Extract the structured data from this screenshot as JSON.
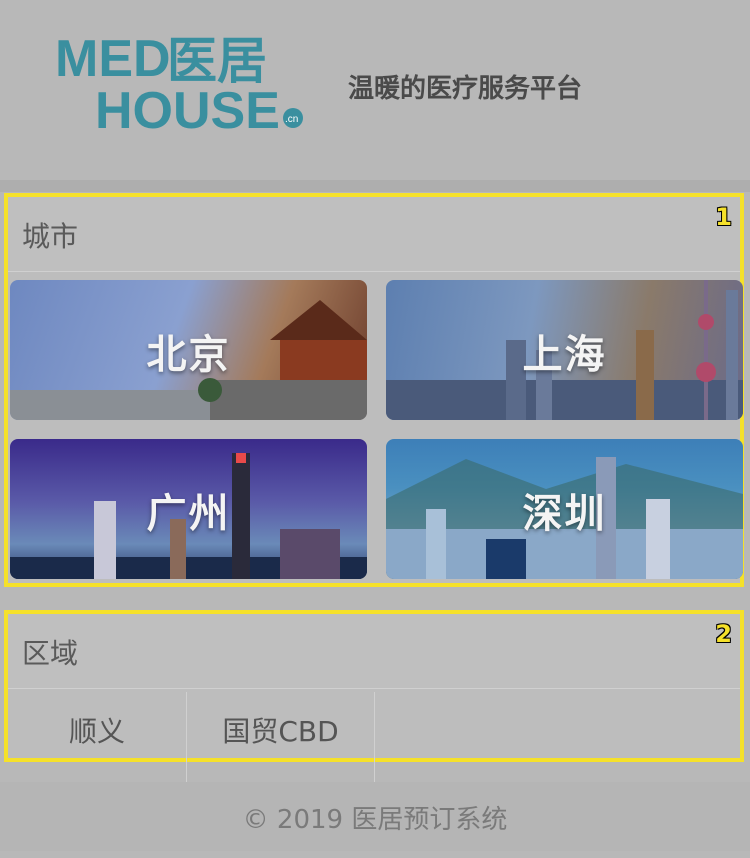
{
  "header": {
    "logo_line1": "MED",
    "logo_cn": "医居",
    "logo_line2": "HOUSE",
    "logo_domain": ".cn",
    "slogan": "温暖的医疗服务平台"
  },
  "cities_panel": {
    "title": "城市",
    "badge": "1",
    "cities": [
      {
        "name": "北京"
      },
      {
        "name": "上海"
      },
      {
        "name": "广州"
      },
      {
        "name": "深圳"
      }
    ]
  },
  "regions_panel": {
    "title": "区域",
    "badge": "2",
    "regions": [
      {
        "name": "顺义"
      },
      {
        "name": "国贸CBD"
      }
    ]
  },
  "footer": {
    "text": "© 2019 医居预订系统"
  },
  "colors": {
    "logo": "#3a8f9f",
    "highlight_border": "#f5e12a"
  }
}
